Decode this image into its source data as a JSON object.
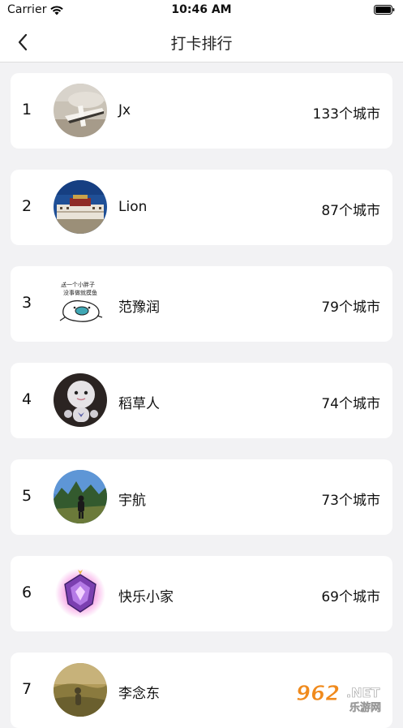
{
  "status_bar": {
    "carrier": "Carrier",
    "time": "10:46 AM"
  },
  "nav": {
    "title": "打卡排行"
  },
  "ranking": [
    {
      "rank": "1",
      "name": "Jx",
      "count": "133个城市"
    },
    {
      "rank": "2",
      "name": "Lion",
      "count": "87个城市"
    },
    {
      "rank": "3",
      "name": "范豫润",
      "count": "79个城市"
    },
    {
      "rank": "4",
      "name": "稻草人",
      "count": "74个城市"
    },
    {
      "rank": "5",
      "name": "宇航",
      "count": "73个城市"
    },
    {
      "rank": "6",
      "name": "快乐小家",
      "count": "69个城市"
    },
    {
      "rank": "7",
      "name": "李念东",
      "count": ""
    }
  ],
  "avatar_3_caption": [
    "送一个小胖子",
    "没事做就摸鱼"
  ],
  "watermark": {
    "digits": "962",
    "suffix": ".NET",
    "tagline": "乐游网"
  },
  "colors": {
    "background": "#f2f2f4",
    "card": "#ffffff",
    "text": "#111111",
    "watermark_orange": "#f08a1c"
  }
}
